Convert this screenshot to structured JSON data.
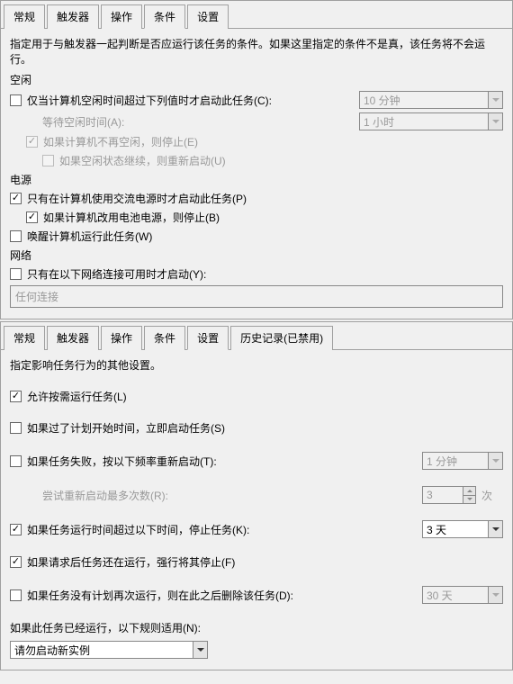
{
  "panel1": {
    "tabs": [
      "常规",
      "触发器",
      "操作",
      "条件",
      "设置"
    ],
    "activeTab": 3,
    "desc": "指定用于与触发器一起判断是否应运行该任务的条件。如果这里指定的条件不是真，该任务将不会运行。",
    "idle": {
      "section": "空闲",
      "startIfIdle": {
        "checked": false,
        "label": "仅当计算机空闲时间超过下列值时才启动此任务(C):"
      },
      "idleDuration": "10 分钟",
      "waitLabel": "等待空闲时间(A):",
      "waitDuration": "1 小时",
      "stopIfNotIdle": {
        "checked": true,
        "label": "如果计算机不再空闲，则停止(E)"
      },
      "restartIfIdle": {
        "checked": false,
        "label": "如果空闲状态继续，则重新启动(U)"
      }
    },
    "power": {
      "section": "电源",
      "onlyAC": {
        "checked": true,
        "label": "只有在计算机使用交流电源时才启动此任务(P)"
      },
      "stopOnBattery": {
        "checked": true,
        "label": "如果计算机改用电池电源，则停止(B)"
      },
      "wakeToRun": {
        "checked": false,
        "label": "唤醒计算机运行此任务(W)"
      }
    },
    "network": {
      "section": "网络",
      "onlyIfNet": {
        "checked": false,
        "label": "只有在以下网络连接可用时才启动(Y):"
      },
      "connection": "任何连接"
    }
  },
  "panel2": {
    "tabs": [
      "常规",
      "触发器",
      "操作",
      "条件",
      "设置",
      "历史记录(已禁用)"
    ],
    "activeTab": 4,
    "desc": "指定影响任务行为的其他设置。",
    "allowOnDemand": {
      "checked": true,
      "label": "允许按需运行任务(L)"
    },
    "runIfMissed": {
      "checked": false,
      "label": "如果过了计划开始时间，立即启动任务(S)"
    },
    "restartOnFail": {
      "checked": false,
      "label": "如果任务失败，按以下频率重新启动(T):"
    },
    "restartInterval": "1 分钟",
    "retryCountLabel": "尝试重新启动最多次数(R):",
    "retryCount": "3",
    "retrySuffix": "次",
    "stopIfLong": {
      "checked": true,
      "label": "如果任务运行时间超过以下时间，停止任务(K):"
    },
    "stopAfter": "3 天",
    "forceStop": {
      "checked": true,
      "label": "如果请求后任务还在运行，强行将其停止(F)"
    },
    "deleteIfNoSched": {
      "checked": false,
      "label": "如果任务没有计划再次运行，则在此之后删除该任务(D):"
    },
    "deleteAfter": "30 天",
    "ruleLabel": "如果此任务已经运行，以下规则适用(N):",
    "ruleValue": "请勿启动新实例"
  }
}
